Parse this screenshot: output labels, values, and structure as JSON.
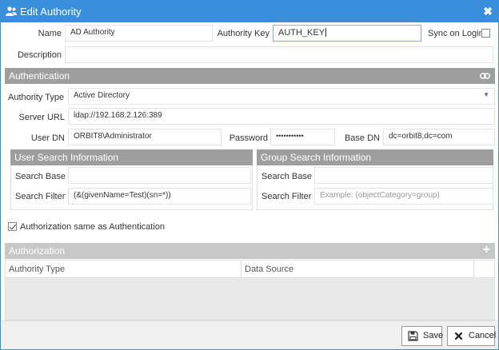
{
  "window": {
    "title": "Edit Authority",
    "close_glyph": "✖"
  },
  "form": {
    "name_label": "Name",
    "name_value": "AD Authority",
    "authority_key_label": "Authority Key",
    "authority_key_value": "AUTH_KEY",
    "sync_on_login_label": "Sync on Login",
    "sync_on_login_checked": false,
    "description_label": "Description",
    "description_value": ""
  },
  "authentication": {
    "header": "Authentication",
    "authority_type_label": "Authority Type",
    "authority_type_value": "Active Directory",
    "server_url_label": "Server URL",
    "server_url_value": "ldap://192.168.2.126:389",
    "user_dn_label": "User DN",
    "user_dn_value": "ORBIT8\\Administrator",
    "password_label": "Password",
    "password_value": "•••••••••••",
    "base_dn_label": "Base DN",
    "base_dn_value": "dc=orbit8,dc=com",
    "user_search": {
      "header": "User Search Information",
      "search_base_label": "Search Base",
      "search_base_value": "",
      "search_filter_label": "Search Filter",
      "search_filter_value": "(&(givenName=Test)(sn=*))"
    },
    "group_search": {
      "header": "Group Search Information",
      "search_base_label": "Search Base",
      "search_base_value": "",
      "search_filter_label": "Search Filter",
      "search_filter_placeholder": "Example: (objectCategory=group)"
    }
  },
  "authorization_same_label": "Authorization same as Authentication",
  "authorization_same_checked": true,
  "authorization": {
    "header": "Authorization",
    "add_glyph": "+",
    "columns": [
      "Authority Type",
      "Data Source"
    ]
  },
  "footer": {
    "save_label": "Save",
    "cancel_label": "Cancel"
  },
  "colors": {
    "titlebar": "#3a8fdc",
    "section_header": "#9e9e9e",
    "section_header_disabled": "#c7c7c7"
  }
}
